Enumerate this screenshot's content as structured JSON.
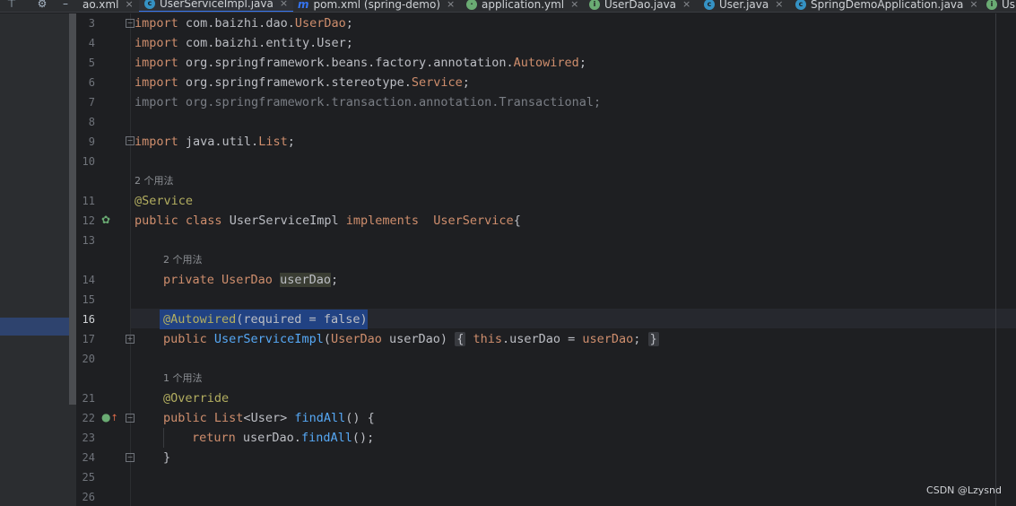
{
  "tabs": [
    {
      "label": "ao.xml",
      "icon": "xml-file-icon"
    },
    {
      "label": "UserServiceImpl.java",
      "icon": "java-class-icon",
      "active": true
    },
    {
      "label": "pom.xml (spring-demo)",
      "icon": "maven-icon"
    },
    {
      "label": "application.yml",
      "icon": "yaml-file-icon"
    },
    {
      "label": "UserDao.java",
      "icon": "java-interface-icon"
    },
    {
      "label": "User.java",
      "icon": "java-class-icon"
    },
    {
      "label": "SpringDemoApplication.java",
      "icon": "spring-boot-icon"
    },
    {
      "label": "Us",
      "icon": "java-interface-icon"
    }
  ],
  "line_numbers": [
    "3",
    "4",
    "5",
    "6",
    "7",
    "8",
    "9",
    "10",
    "11",
    "12",
    "13",
    "14",
    "15",
    "16",
    "17",
    "20",
    "21",
    "22",
    "23",
    "24",
    "25",
    "26"
  ],
  "current_line": "16",
  "code": {
    "l3": {
      "kw": "import",
      "pkg": " com.baizhi.dao.",
      "cls": "UserDao",
      "end": ";"
    },
    "l4": {
      "kw": "import",
      "pkg": " com.baizhi.entity.User;"
    },
    "l5": {
      "kw": "import",
      "pkg": " org.springframework.beans.factory.annotation.",
      "cls": "Autowired",
      "end": ";"
    },
    "l6": {
      "kw": "import",
      "pkg": " org.springframework.stereotype.",
      "cls": "Service",
      "end": ";"
    },
    "l7": {
      "text": "import org.springframework.transaction.annotation.Transactional;"
    },
    "l9": {
      "kw": "import",
      "pkg": " java.util.",
      "cls": "List",
      "end": ";"
    },
    "hint_class": "2 个用法",
    "l11": {
      "ann": "@Service"
    },
    "l12": {
      "kw1": "public",
      "kw2": " class ",
      "name": "UserServiceImpl ",
      "kw3": "implements",
      "iface": "  UserService",
      "end": "{"
    },
    "hint_field": "2 个用法",
    "l14": {
      "kw": "private ",
      "type": "UserDao ",
      "name": "userDao",
      "end": ";"
    },
    "l16": {
      "ann": "@Autowired",
      "args": "(required = false)"
    },
    "l17": {
      "kw": "public ",
      "name": "UserServiceImpl",
      "params_open": "(",
      "ptype": "UserDao ",
      "pname": "userDao",
      "params_close": ")",
      "lb": "{",
      "this": " this",
      "body": ".userDao = ",
      "val": "userDao",
      "semi": ";",
      "rb": "}"
    },
    "hint_method": "1 个用法",
    "l21": {
      "ann": "@Override"
    },
    "l22": {
      "kw": "public ",
      "type": "List",
      "gen": "<",
      "gtype": "User",
      "gen2": "> ",
      "fn": "findAll",
      "end": "() {"
    },
    "l23": {
      "kw": "return ",
      "obj": "userDao.",
      "fn": "findAll",
      "end": "();"
    },
    "l24": {
      "text": "}"
    }
  },
  "watermark": "CSDN @Lzysnd"
}
